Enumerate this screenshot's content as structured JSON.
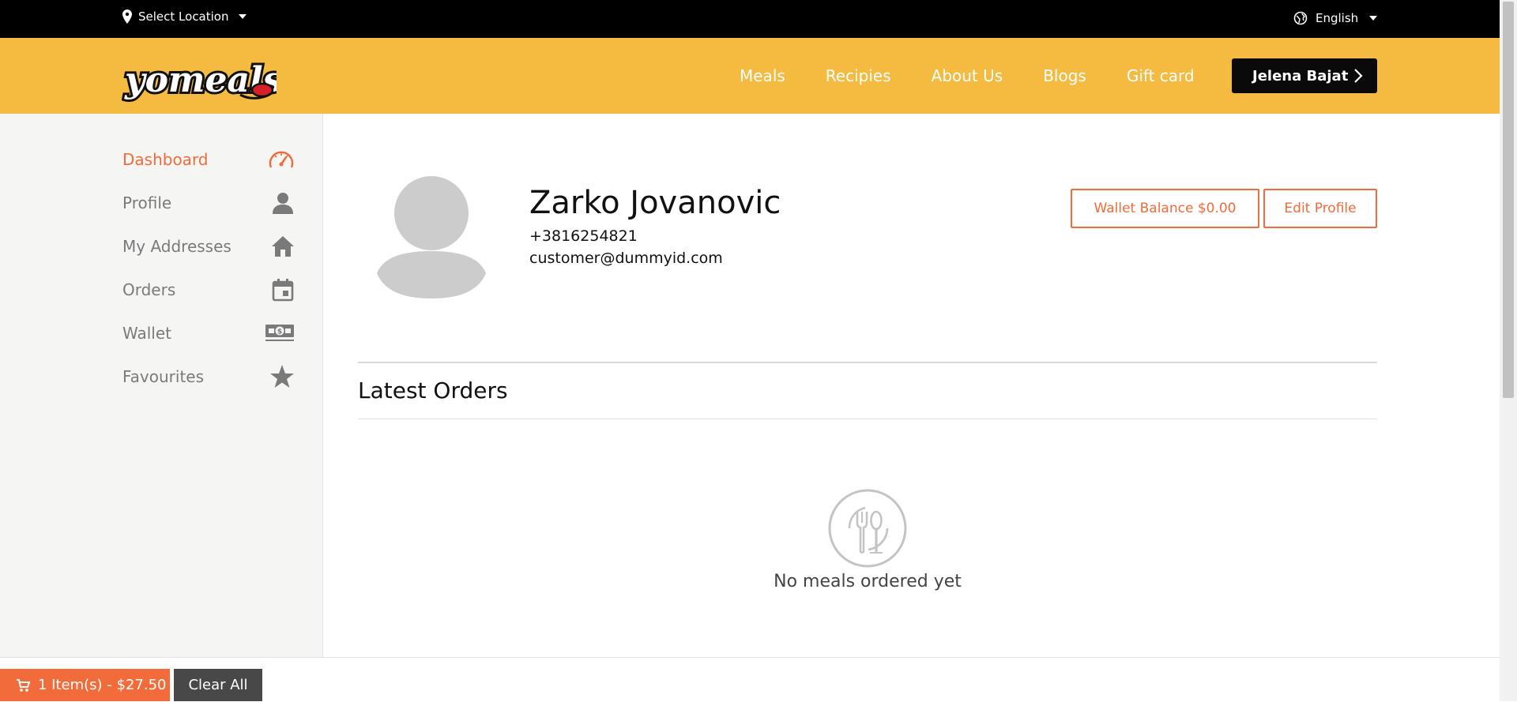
{
  "topbar": {
    "location_label": "Select Location",
    "language_label": "English",
    "icons": {
      "location": "map-pin-icon",
      "language": "globe-icon"
    }
  },
  "header": {
    "logo_text": "yomeals",
    "nav": [
      {
        "label": "Meals"
      },
      {
        "label": "Recipies"
      },
      {
        "label": "About Us"
      },
      {
        "label": "Blogs"
      },
      {
        "label": "Gift card"
      }
    ],
    "user_button_label": "Jelena Bajat"
  },
  "sidebar": {
    "items": [
      {
        "label": "Dashboard",
        "icon": "speedometer-icon",
        "active": true
      },
      {
        "label": "Profile",
        "icon": "user-icon",
        "active": false
      },
      {
        "label": "My Addresses",
        "icon": "home-icon",
        "active": false
      },
      {
        "label": "Orders",
        "icon": "calendar-icon",
        "active": false
      },
      {
        "label": "Wallet",
        "icon": "money-icon",
        "active": false
      },
      {
        "label": "Favourites",
        "icon": "star-icon",
        "active": false
      }
    ]
  },
  "profile": {
    "name": "Zarko Jovanovic",
    "phone": "+3816254821",
    "email": "customer@dummyid.com",
    "wallet_button": "Wallet Balance $0.00",
    "edit_button": "Edit Profile"
  },
  "orders": {
    "title": "Latest Orders",
    "empty_text": "No meals ordered yet",
    "empty_icon": "fork-spoon-icon"
  },
  "cartbar": {
    "cart_label": "1 Item(s) - $27.50",
    "clear_label": "Clear All",
    "cart_icon": "cart-icon"
  },
  "colors": {
    "accent": "#f26b3a",
    "header": "#f5bb40",
    "topbar": "#000000",
    "sidebar": "#f5f5f4"
  }
}
